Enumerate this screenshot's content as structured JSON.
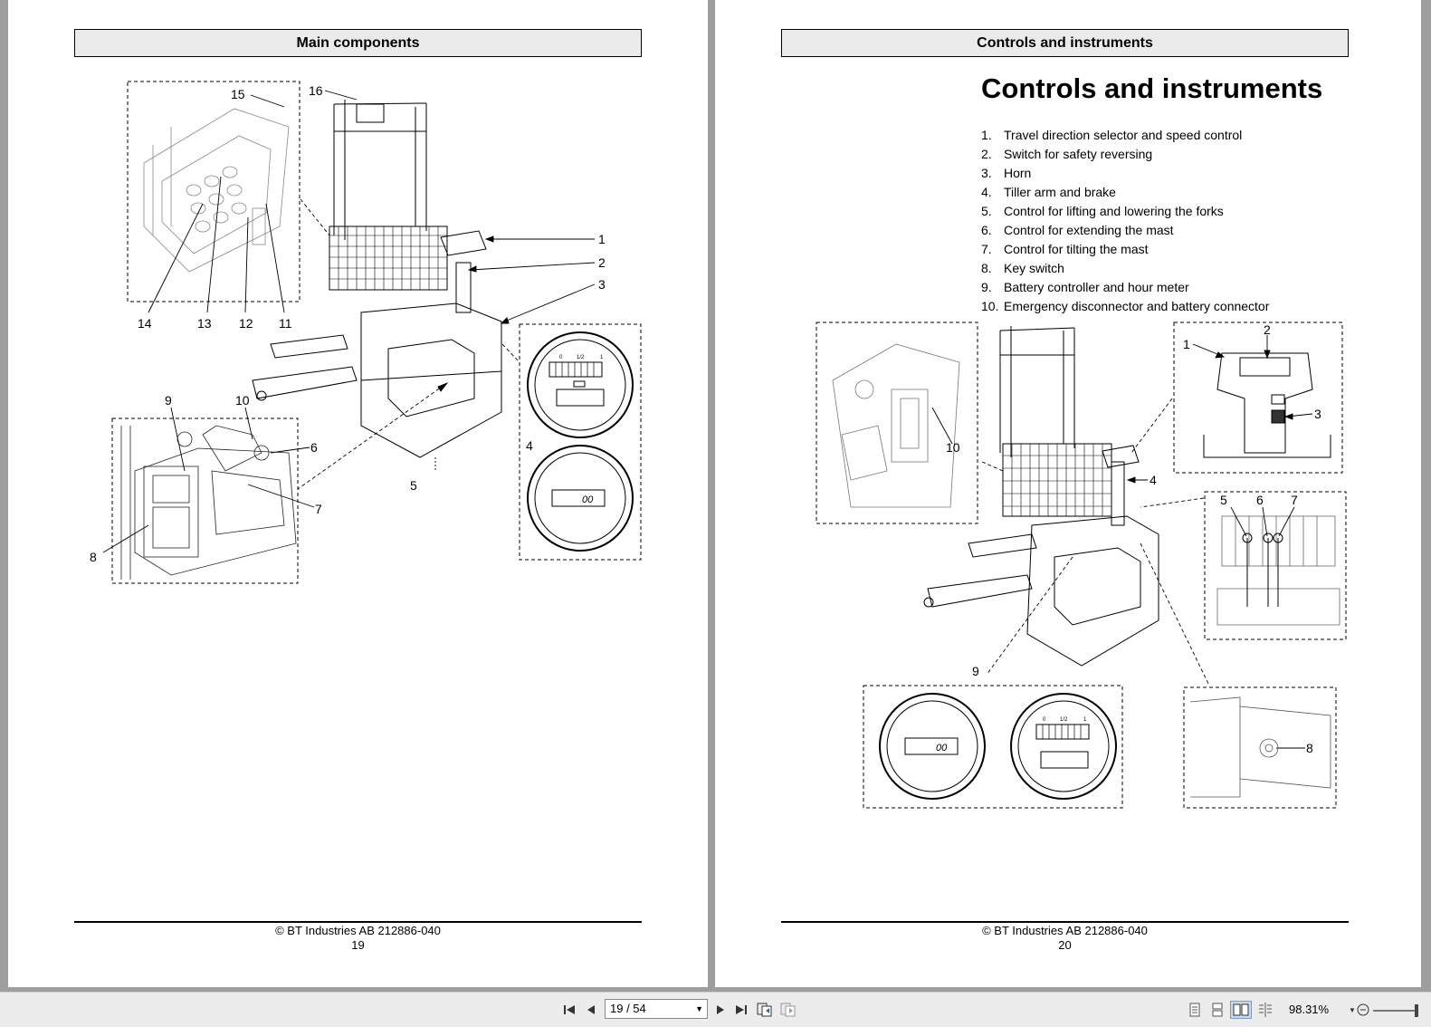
{
  "left_page": {
    "header": "Main components",
    "callouts": [
      "1",
      "2",
      "3",
      "4",
      "5",
      "6",
      "7",
      "8",
      "9",
      "10",
      "11",
      "12",
      "13",
      "14",
      "15",
      "16"
    ],
    "footer": "© BT Industries AB 212886-040",
    "page_number": "19"
  },
  "right_page": {
    "header": "Controls and instruments",
    "title": "Controls and instruments",
    "items": [
      {
        "n": "1.",
        "label": "Travel direction selector and speed control"
      },
      {
        "n": "2.",
        "label": "Switch for safety reversing"
      },
      {
        "n": "3.",
        "label": "Horn"
      },
      {
        "n": "4.",
        "label": "Tiller arm and brake"
      },
      {
        "n": "5.",
        "label": "Control for lifting and lowering the forks"
      },
      {
        "n": "6.",
        "label": "Control for extending the mast"
      },
      {
        "n": "7.",
        "label": "Control for tilting the mast"
      },
      {
        "n": "8.",
        "label": "Key switch"
      },
      {
        "n": "9.",
        "label": "Battery controller and hour meter"
      },
      {
        "n": "10.",
        "label": "Emergency disconnector and battery connector"
      }
    ],
    "callouts": [
      "1",
      "2",
      "3",
      "4",
      "5",
      "6",
      "7",
      "8",
      "9",
      "10"
    ],
    "footer": "© BT Industries AB 212886-040",
    "page_number": "20"
  },
  "gauge_text": {
    "scale_mid": "1/2",
    "scale_lo": "0",
    "scale_hi": "1",
    "meter": "00"
  },
  "toolbar": {
    "page_field": "19 / 54",
    "zoom": "98.31%"
  }
}
